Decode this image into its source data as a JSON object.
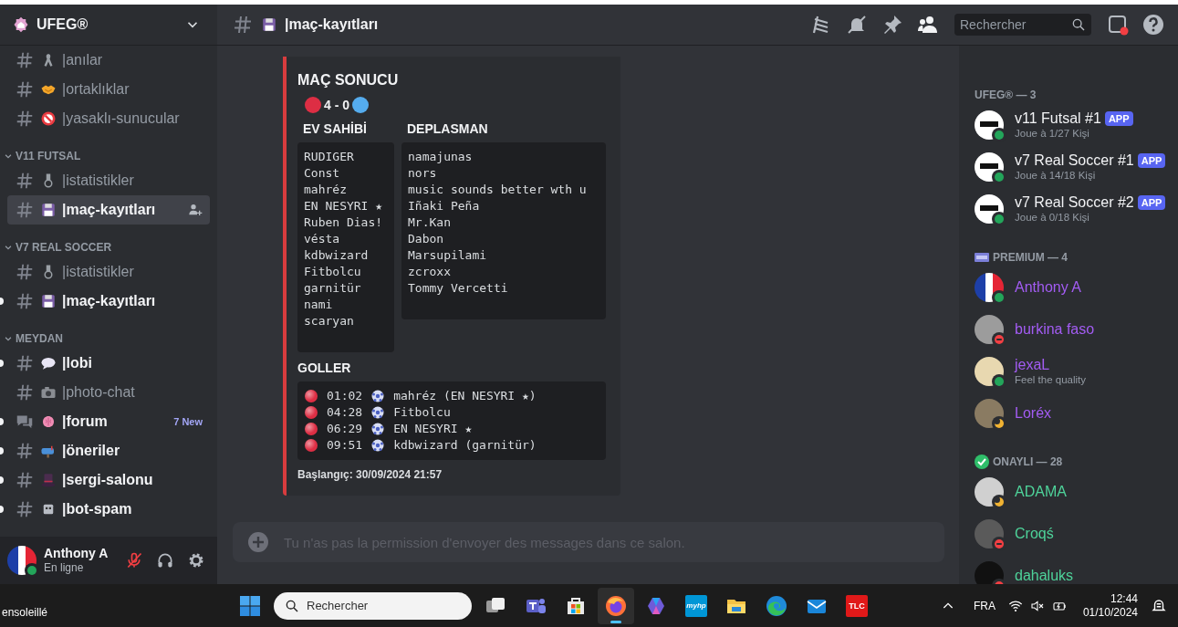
{
  "server": {
    "name": "UFEG®"
  },
  "sidebar": {
    "channels": [
      {
        "kind": "text",
        "name": "|anılar",
        "unread": false,
        "selected": false
      },
      {
        "kind": "text",
        "name": "|ortaklıklar",
        "unread": false,
        "selected": false
      },
      {
        "kind": "text",
        "name": "|yasaklı-sunucular",
        "unread": false,
        "selected": false
      }
    ],
    "categories": [
      {
        "name": "V11 FUTSAL",
        "expanded": true,
        "channels": [
          {
            "kind": "text",
            "name": "|istatistikler",
            "unread": false,
            "selected": false
          },
          {
            "kind": "text",
            "name": "|maç-kayıtları",
            "unread": false,
            "selected": true
          }
        ]
      },
      {
        "name": "V7 REAL SOCCER",
        "expanded": true,
        "channels": [
          {
            "kind": "text",
            "name": "|istatistikler",
            "unread": false,
            "selected": false
          },
          {
            "kind": "text",
            "name": "|maç-kayıtları",
            "unread": true,
            "selected": false
          }
        ]
      },
      {
        "name": "MEYDAN",
        "expanded": true,
        "channels": [
          {
            "kind": "text",
            "name": "|lobi",
            "unread": true,
            "selected": false
          },
          {
            "kind": "text",
            "name": "|photo-chat",
            "unread": false,
            "selected": false
          },
          {
            "kind": "forum",
            "name": "|forum",
            "unread": true,
            "selected": false,
            "badge": "7 New"
          },
          {
            "kind": "text",
            "name": "|öneriler",
            "unread": true,
            "selected": false
          },
          {
            "kind": "text",
            "name": "|sergi-salonu",
            "unread": true,
            "selected": false
          },
          {
            "kind": "text",
            "name": "|bot-spam",
            "unread": true,
            "selected": false
          }
        ]
      }
    ]
  },
  "user": {
    "name": "Anthony A",
    "status_text": "En ligne",
    "presence": {
      "kind": "online"
    },
    "mic_muted": true
  },
  "header": {
    "channel_name": "|maç-kayıtları",
    "search": {
      "placeholder": "Rechercher"
    }
  },
  "embed": {
    "color": "#d83c3e",
    "title": "MAÇ SONUCU",
    "score": {
      "home": {
        "color": "#dd2e44"
      },
      "text": "4 - 0",
      "away": {
        "color": "#55acee"
      }
    },
    "fields": [
      {
        "name": "EV SAHİBİ",
        "lines": [
          "RUDIGER",
          "Const",
          "mahréz",
          "EN NESYRI ★",
          "Ruben Dias!",
          "vésta",
          "kdbwizard",
          "Fitbolcu",
          "garnitür",
          "nami",
          "scaryan"
        ]
      },
      {
        "name": "DEPLASMAN",
        "lines": [
          "namajunas",
          "nors",
          "music sounds better wth u",
          "Iñaki Peña",
          "Mr.Kan",
          "Dabon",
          "Marsupilami",
          "zcroxx",
          "Tommy Vercetti"
        ]
      }
    ],
    "goals_title": "GOLLER",
    "goals": [
      {
        "color": "#dd2e44",
        "time": "01:02",
        "scorer": "mahréz (EN NESYRI ★)"
      },
      {
        "color": "#dd2e44",
        "time": "04:28",
        "scorer": "Fitbolcu"
      },
      {
        "color": "#dd2e44",
        "time": "06:29",
        "scorer": "EN NESYRI ★"
      },
      {
        "color": "#dd2e44",
        "time": "09:51",
        "scorer": "kdbwizard (garnitür)"
      }
    ],
    "footer": "Başlangıç: 30/09/2024 21:57"
  },
  "composer": {
    "placeholder": "Tu n'as pas la permission d'envoyer des messages dans ce salon.",
    "disabled": true
  },
  "members": {
    "groups": [
      {
        "kind": "bots",
        "title": "UFEG® — 3",
        "members": [
          {
            "name": "v11 Futsal #1",
            "avatar": {
              "kind": "logo"
            },
            "color": "#f2f3f5",
            "presence": {
              "kind": "online"
            },
            "badge": "APP",
            "activity": "Joue à 1/27 Kişi"
          },
          {
            "name": "v7 Real Soccer #1",
            "avatar": {
              "kind": "logo"
            },
            "color": "#f2f3f5",
            "presence": {
              "kind": "online"
            },
            "badge": "APP",
            "activity": "Joue à 14/18 Kişi"
          },
          {
            "name": "v7 Real Soccer #2",
            "avatar": {
              "kind": "logo"
            },
            "color": "#f2f3f5",
            "presence": {
              "kind": "online"
            },
            "badge": "APP",
            "activity": "Joue à 0/18 Kişi"
          }
        ]
      },
      {
        "kind": "premium",
        "title": "PREMIUM — 4",
        "members": [
          {
            "name": "Anthony A",
            "avatar": {
              "kind": "flag"
            },
            "color": "#a35cf3",
            "presence": {
              "kind": "online"
            }
          },
          {
            "name": "burkina faso",
            "avatar": {
              "kind": "photo"
            },
            "color": "#a35cf3",
            "presence": {
              "kind": "dnd"
            }
          },
          {
            "name": "jexaL",
            "avatar": {
              "kind": "photo"
            },
            "color": "#a35cf3",
            "presence": {
              "kind": "online"
            },
            "activity": "Feel the quality"
          },
          {
            "name": "Loréx",
            "avatar": {
              "kind": "photo"
            },
            "color": "#a35cf3",
            "presence": {
              "kind": "idle"
            }
          }
        ]
      },
      {
        "kind": "verified",
        "title": "ONAYLI — 28",
        "members": [
          {
            "name": "ADAMA",
            "avatar": {
              "kind": "photo"
            },
            "color": "#4ed39a",
            "presence": {
              "kind": "idle"
            }
          },
          {
            "name": "Croqś",
            "avatar": {
              "kind": "photo"
            },
            "color": "#4ed39a",
            "presence": {
              "kind": "dnd"
            }
          },
          {
            "name": "dahaluks",
            "avatar": {
              "kind": "photo"
            },
            "color": "#4ed39a",
            "presence": {
              "kind": "dnd"
            }
          }
        ]
      }
    ]
  },
  "taskbar": {
    "weather": "ensoleillé",
    "search": {
      "placeholder": "Rechercher"
    },
    "apps": [
      {
        "kind": "task-view",
        "selected": false
      },
      {
        "kind": "teams",
        "selected": false
      },
      {
        "kind": "store",
        "selected": false
      },
      {
        "kind": "firefox",
        "selected": true
      },
      {
        "kind": "copilot",
        "selected": false
      },
      {
        "kind": "myhp",
        "label": "myhp",
        "selected": false
      },
      {
        "kind": "files",
        "selected": false
      },
      {
        "kind": "edge",
        "selected": false
      },
      {
        "kind": "mail",
        "selected": false
      },
      {
        "kind": "tlc",
        "label": "TLC",
        "selected": false
      }
    ],
    "language": "FRA",
    "time": "12:44",
    "date": "01/10/2024"
  }
}
